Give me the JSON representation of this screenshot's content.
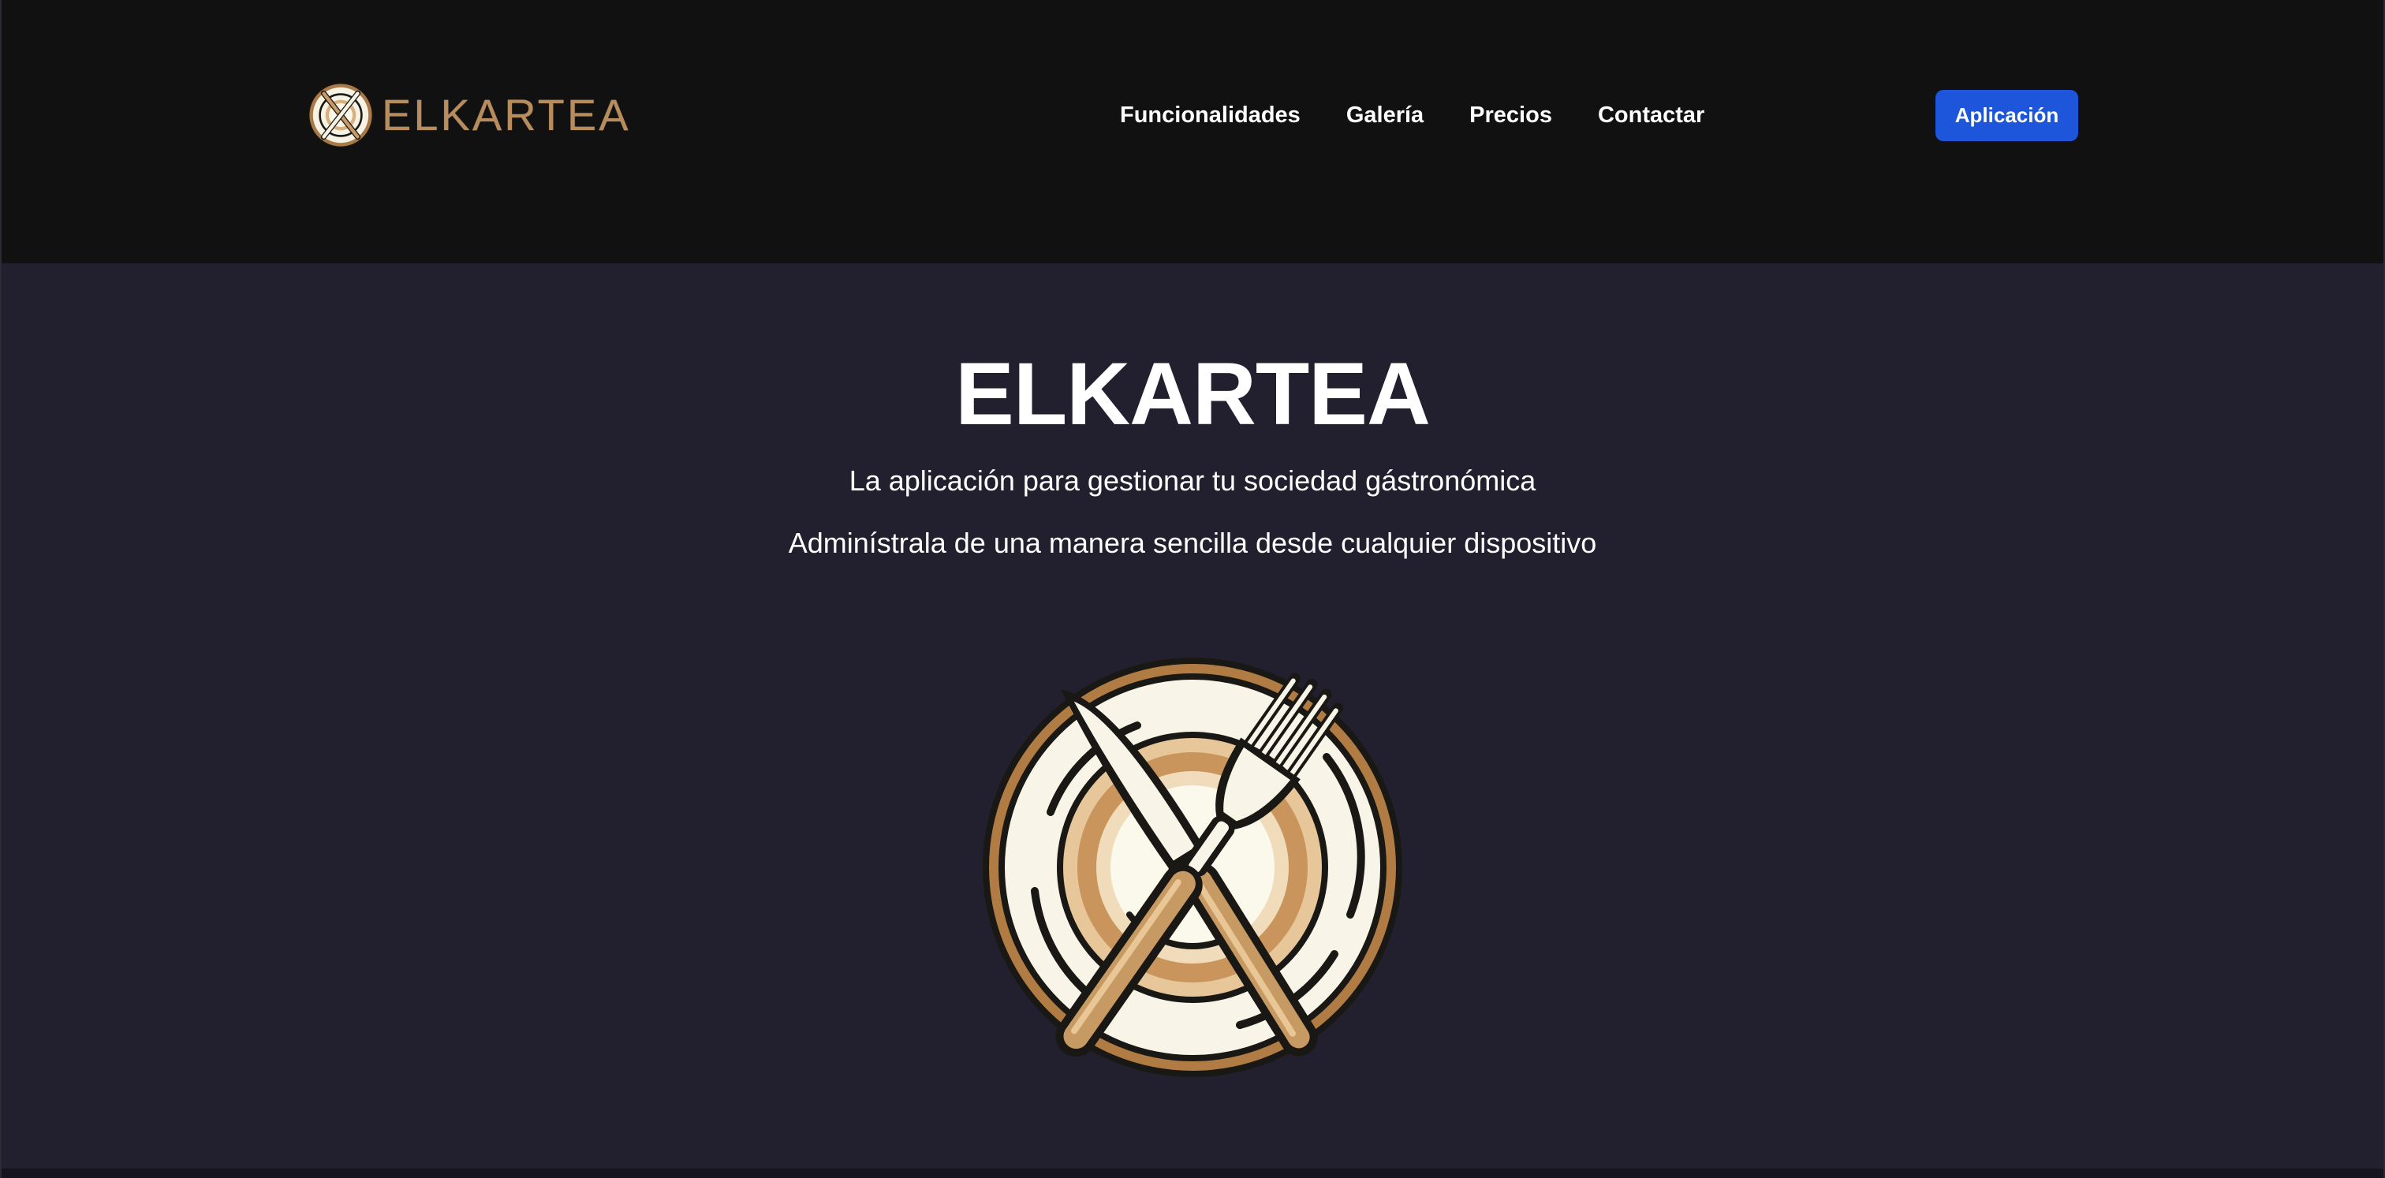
{
  "header": {
    "brand_name": "ELKARTEA",
    "nav": [
      {
        "label": "Funcionalidades"
      },
      {
        "label": "Galería"
      },
      {
        "label": "Precios"
      },
      {
        "label": "Contactar"
      }
    ],
    "app_button_label": "Aplicación"
  },
  "hero": {
    "title": "ELKARTEA",
    "subtitle": "La aplicación para gestionar tu sociedad gástronómica",
    "tagline": "Adminístrala de una manera sencilla desde cualquier dispositivo",
    "logo_icon": "plate-knife-fork-icon"
  },
  "colors": {
    "header_bg": "#111112",
    "hero_bg": "#221f2e",
    "brand_gold": "#b98c5b",
    "button_blue": "#1d56db"
  }
}
